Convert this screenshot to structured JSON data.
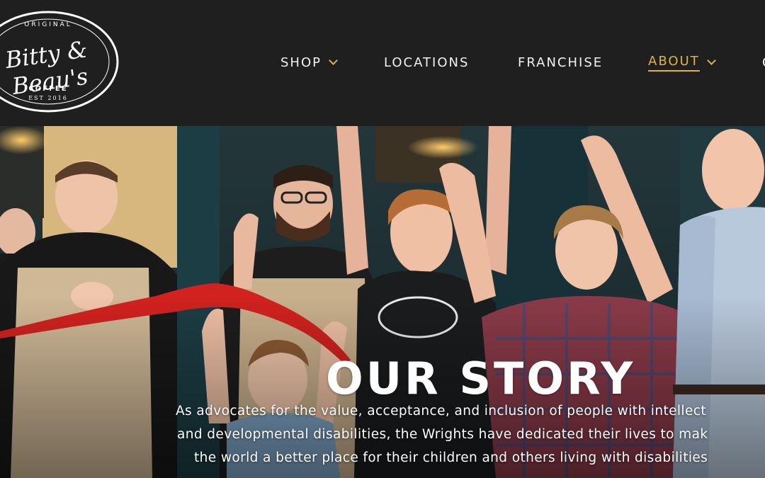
{
  "brand": {
    "logo_top": "ORIGINAL",
    "logo_script": "Bitty & Beau's",
    "logo_coffee": "COFFEE",
    "logo_est": "EST 2016"
  },
  "nav": {
    "items": [
      {
        "label": "SHOP",
        "has_dropdown": true,
        "active": false
      },
      {
        "label": "LOCATIONS",
        "has_dropdown": false,
        "active": false
      },
      {
        "label": "FRANCHISE",
        "has_dropdown": false,
        "active": false
      },
      {
        "label": "ABOUT",
        "has_dropdown": true,
        "active": true
      },
      {
        "label": "C",
        "has_dropdown": false,
        "active": false
      }
    ],
    "accent_color": "#e3b23c"
  },
  "hero": {
    "title": "OUR STORY",
    "lines": [
      "As advocates for the value, acceptance, and inclusion of people with intellect",
      "and developmental disabilities, the Wrights have dedicated their lives to mak",
      "the world a better place for their children and others living with disabilities"
    ],
    "image_alt": "Ribbon-cutting celebration with staff and family cheering"
  },
  "colors": {
    "header_bg": "#1f1f1f",
    "ribbon": "#d1221f",
    "text": "#ffffff"
  }
}
